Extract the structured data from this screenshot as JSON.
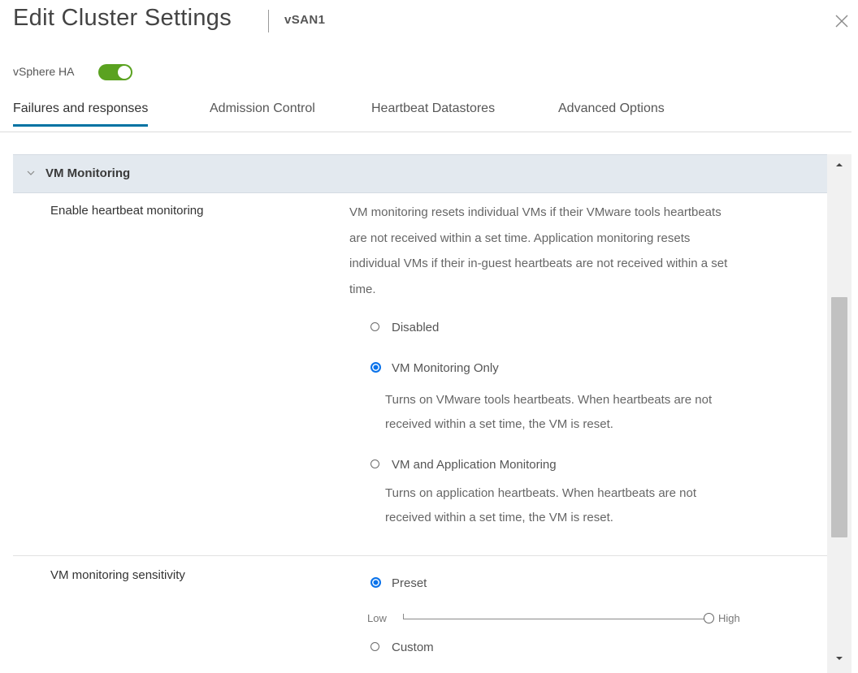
{
  "dialog": {
    "title": "Edit Cluster Settings",
    "subtitle": "vSAN1",
    "close_icon": "close-icon"
  },
  "ha": {
    "label": "vSphere HA",
    "enabled": true,
    "accent": "#5aa220"
  },
  "tabs": [
    {
      "label": "Failures and responses",
      "active": true
    },
    {
      "label": "Admission Control",
      "active": false
    },
    {
      "label": "Heartbeat Datastores",
      "active": false
    },
    {
      "label": "Advanced Options",
      "active": false
    }
  ],
  "section": {
    "title": "VM Monitoring",
    "expanded": true,
    "icon": "chevron-down-icon"
  },
  "heartbeat": {
    "label": "Enable heartbeat monitoring",
    "description_lines": [
      "VM monitoring resets individual VMs if their VMware tools heartbeats",
      "are not received within a set time. Application monitoring resets",
      "individual VMs if their in-guest heartbeats are not received within a set",
      "time."
    ],
    "options": [
      {
        "label": "Disabled",
        "checked": false,
        "description_lines": []
      },
      {
        "label": "VM Monitoring Only",
        "checked": true,
        "description_lines": [
          "Turns on VMware tools heartbeats. When heartbeats are not",
          "received within a set time, the VM is reset."
        ]
      },
      {
        "label": "VM and Application Monitoring",
        "checked": false,
        "description_lines": [
          "Turns on application heartbeats. When heartbeats are not",
          "received within a set time, the VM is reset."
        ]
      }
    ]
  },
  "sensitivity": {
    "label": "VM monitoring sensitivity",
    "options": [
      {
        "label": "Preset",
        "checked": true
      },
      {
        "label": "Custom",
        "checked": false
      }
    ],
    "slider": {
      "low_label": "Low",
      "high_label": "High",
      "value_fraction": 1.0
    }
  },
  "colors": {
    "radio_checked": "#0b73ea",
    "tab_underline": "#0072a3",
    "section_bg": "#e3e9ef"
  }
}
